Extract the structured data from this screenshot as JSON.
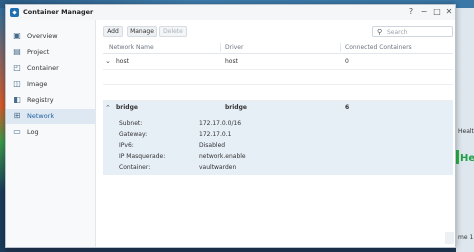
{
  "window": {
    "title": "Container Manager"
  },
  "sidebar": {
    "items": [
      {
        "label": "Overview",
        "icon": "overview-icon"
      },
      {
        "label": "Project",
        "icon": "project-icon"
      },
      {
        "label": "Container",
        "icon": "container-icon"
      },
      {
        "label": "Image",
        "icon": "image-icon"
      },
      {
        "label": "Registry",
        "icon": "registry-icon"
      },
      {
        "label": "Network",
        "icon": "network-icon",
        "active": true
      },
      {
        "label": "Log",
        "icon": "log-icon"
      }
    ]
  },
  "toolbar": {
    "add_label": "Add",
    "manage_label": "Manage",
    "delete_label": "Delete",
    "search_placeholder": "Search"
  },
  "table": {
    "columns": [
      "Network Name",
      "Driver",
      "Connected Containers"
    ],
    "rows": [
      {
        "name": "host",
        "driver": "host",
        "connected": "0",
        "expanded": false
      },
      {
        "name": "bridge",
        "driver": "bridge",
        "connected": "6",
        "expanded": true
      }
    ],
    "bridge_details": [
      {
        "label": "Subnet:",
        "value": "172.17.0.0/16"
      },
      {
        "label": "Gateway:",
        "value": "172.17.0.1"
      },
      {
        "label": "IPv6:",
        "value": "Disabled"
      },
      {
        "label": "IP Masquerade:",
        "value": "network.enable"
      },
      {
        "label": "Container:",
        "value": "vaultwarden"
      }
    ]
  },
  "background": {
    "peek_a": "Healt",
    "peek_b": "Hea",
    "peek_c": "me 1"
  },
  "colors": {
    "accent": "#1e5f9e",
    "selected_row": "#e6eef6",
    "active_nav": "#dde8f3"
  }
}
